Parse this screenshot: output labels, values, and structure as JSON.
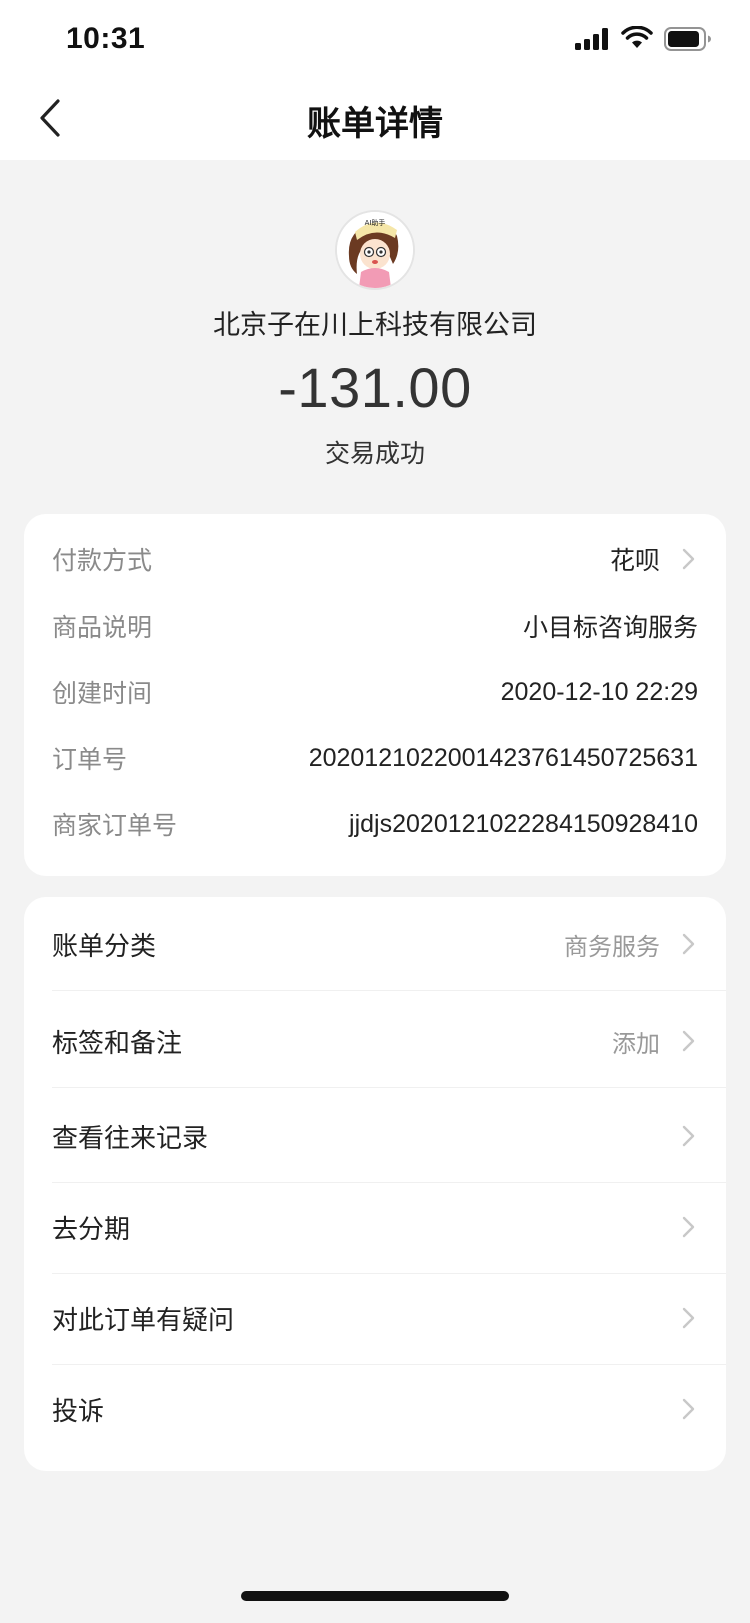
{
  "status_bar": {
    "time": "10:31"
  },
  "nav": {
    "title": "账单详情"
  },
  "transaction": {
    "merchant": "北京子在川上科技有限公司",
    "amount": "-131.00",
    "status": "交易成功",
    "avatar_text": "AI助手"
  },
  "details": [
    {
      "label": "付款方式",
      "value": "花呗",
      "has_arrow": true
    },
    {
      "label": "商品说明",
      "value": "小目标咨询服务"
    },
    {
      "label": "创建时间",
      "value": "2020-12-10 22:29"
    },
    {
      "label": "订单号",
      "value": "2020121022001423761450725631"
    },
    {
      "label": "商家订单号",
      "value": "jjdjs20201210222841509284​10"
    }
  ],
  "menu": [
    {
      "label": "账单分类",
      "value": "商务服务"
    },
    {
      "label": "标签和备注",
      "value": "添加"
    },
    {
      "label": "查看往来记录",
      "value": ""
    },
    {
      "label": "去分期",
      "value": ""
    },
    {
      "label": "对此订单有疑问",
      "value": ""
    },
    {
      "label": "投诉",
      "value": ""
    }
  ],
  "colors": {
    "background": "#f3f3f3",
    "card": "#ffffff",
    "label_gray": "#8a8a8a",
    "chevron": "#c8c8c8"
  }
}
